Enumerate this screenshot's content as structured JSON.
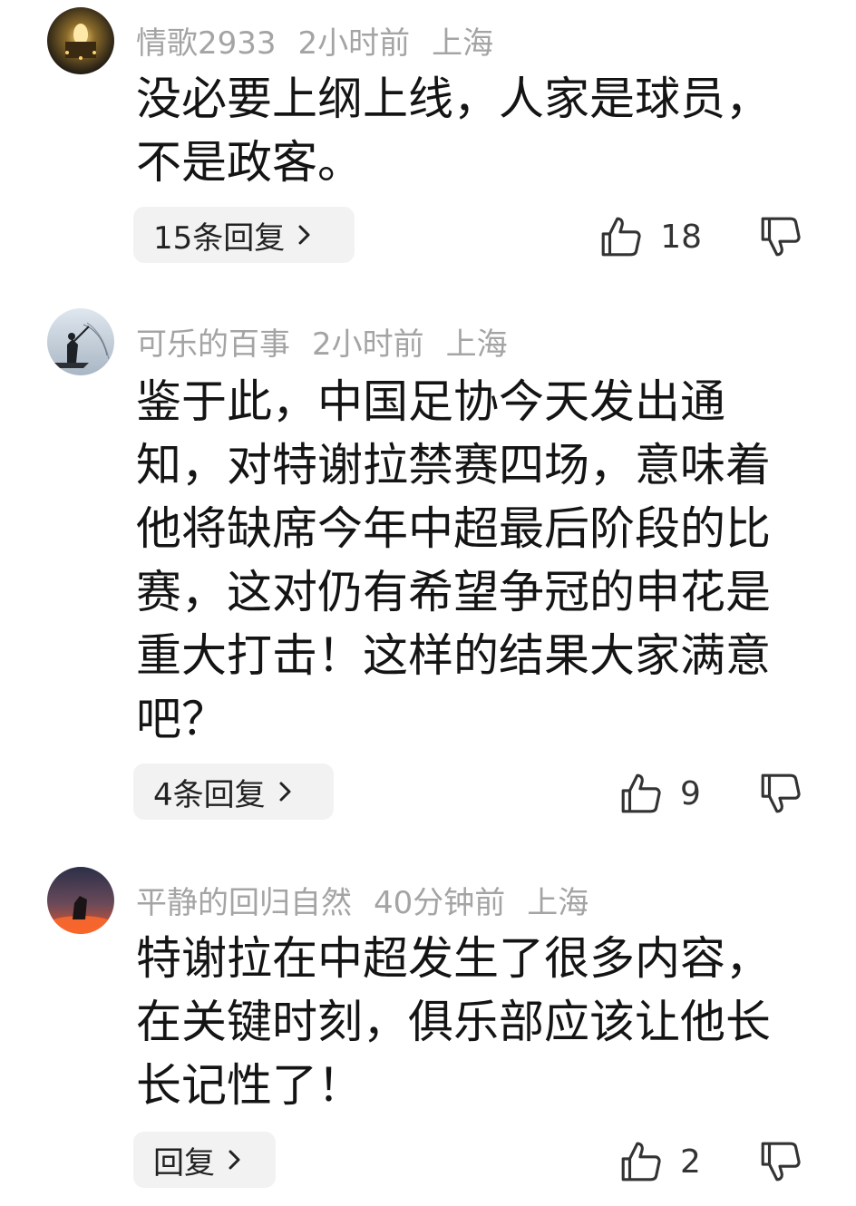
{
  "comments": [
    {
      "user": "情歌2933",
      "time": "2小时前",
      "location": "上海",
      "text": "没必要上纲上线，人家是球员，不是政客。",
      "reply_label": "15条回复",
      "likes": "18",
      "avatar_icon": "night-tower-avatar"
    },
    {
      "user": "可乐的百事",
      "time": "2小时前",
      "location": "上海",
      "text": "鉴于此，中国足协今天发出通知，对特谢拉禁赛四场，意味着他将缺席今年中超最后阶段的比赛，这对仍有希望争冠的申花是重大打击！这样的结果大家满意吧？",
      "reply_label": "4条回复",
      "likes": "9",
      "avatar_icon": "fisherman-avatar"
    },
    {
      "user": "平静的回归自然",
      "time": "40分钟前",
      "location": "上海",
      "text": "特谢拉在中超发生了很多内容，在关键时刻，俱乐部应该让他长长记性了！",
      "reply_label": "回复",
      "likes": "2",
      "avatar_icon": "sunset-avatar"
    }
  ],
  "icons": {
    "like": "thumbs-up-icon",
    "dislike": "thumbs-down-icon",
    "chevron": "chevron-right-icon"
  },
  "colors": {
    "meta_text": "#a4a4a4",
    "body_text": "#141414",
    "reply_bg": "#f2f2f2"
  }
}
